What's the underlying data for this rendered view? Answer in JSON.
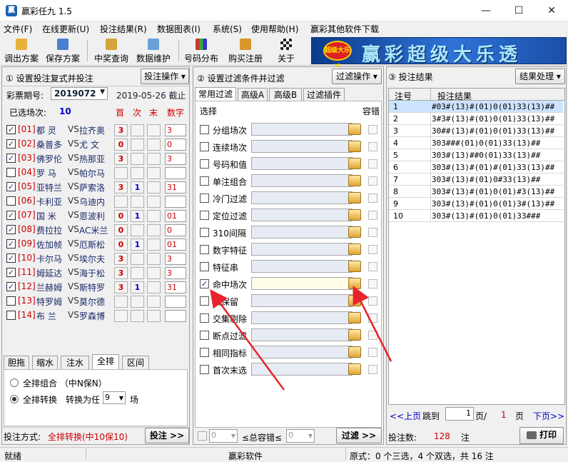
{
  "window": {
    "title": "赢彩任九 1.5",
    "min": "—",
    "max": "☐",
    "close": "✕",
    "icon": "app-icon"
  },
  "menu": [
    "文件(F)",
    "在线更新(U)",
    "投注结果(R)",
    "数据图表(I)",
    "系统(S)",
    "使用帮助(H)",
    "赢彩其他软件下载"
  ],
  "toolbar": [
    "调出方案",
    "保存方案",
    "中奖查询",
    "数据维护",
    "号码分布",
    "购买注册",
    "关于"
  ],
  "banner": {
    "logo": "超级大乐透",
    "text": "赢彩超级大乐透"
  },
  "left": {
    "title": "① 设置投注复式并投注",
    "action_button": "投注操作 ▾",
    "period_label": "彩票期号:",
    "period": "2019072",
    "date": "2019-05-26 截止",
    "selected_label": "已选场次:",
    "selected_count": "10",
    "col_headers": [
      "首",
      "次",
      "末",
      "数字"
    ],
    "matches": [
      {
        "checked": true,
        "no": "[01]",
        "home": "都 灵",
        "away": "拉齐奥",
        "c1": "3",
        "c2": "",
        "c3": "",
        "num": "3"
      },
      {
        "checked": true,
        "no": "[02]",
        "home": "桑普多",
        "away": "尤 文",
        "c1": "0",
        "c2": "",
        "c3": "",
        "num": "0"
      },
      {
        "checked": true,
        "no": "[03]",
        "home": "佛罗伦",
        "away": "热那亚",
        "c1": "3",
        "c2": "",
        "c3": "",
        "num": "3"
      },
      {
        "checked": false,
        "no": "[04]",
        "home": "罗 马",
        "away": "帕尔马",
        "c1": "",
        "c2": "",
        "c3": "",
        "num": ""
      },
      {
        "checked": true,
        "no": "[05]",
        "home": "亚特兰",
        "away": "萨索洛",
        "c1": "3",
        "c2": "1",
        "c3": "",
        "num": "31"
      },
      {
        "checked": false,
        "no": "[06]",
        "home": "卡利亚",
        "away": "乌迪内",
        "c1": "",
        "c2": "",
        "c3": "",
        "num": ""
      },
      {
        "checked": true,
        "no": "[07]",
        "home": "国 米",
        "away": "恩波利",
        "c1": "0",
        "c2": "1",
        "c3": "",
        "num": "01"
      },
      {
        "checked": true,
        "no": "[08]",
        "home": "费拉拉",
        "away": "AC米兰",
        "c1": "0",
        "c2": "",
        "c3": "",
        "num": "0"
      },
      {
        "checked": true,
        "no": "[09]",
        "home": "佐加帧",
        "away": "厄斯松",
        "c1": "0",
        "c2": "1",
        "c3": "",
        "num": "01"
      },
      {
        "checked": true,
        "no": "[10]",
        "home": "卡尔马",
        "away": "埃尔夫",
        "c1": "3",
        "c2": "",
        "c3": "",
        "num": "3"
      },
      {
        "checked": true,
        "no": "[11]",
        "home": "姆延达",
        "away": "海于松",
        "c1": "3",
        "c2": "",
        "c3": "",
        "num": "3"
      },
      {
        "checked": true,
        "no": "[12]",
        "home": "兰赫姆",
        "away": "斯特罗",
        "c1": "3",
        "c2": "1",
        "c3": "",
        "num": "31"
      },
      {
        "checked": false,
        "no": "[13]",
        "home": "特罗姆",
        "away": "莫尔德",
        "c1": "",
        "c2": "",
        "c3": "",
        "num": ""
      },
      {
        "checked": false,
        "no": "[14]",
        "home": "布 兰",
        "away": "罗森博",
        "c1": "",
        "c2": "",
        "c3": "",
        "num": ""
      }
    ],
    "vs": "VS",
    "tabs": [
      "胆拖",
      "缩水",
      "注水",
      "全排",
      "区间"
    ],
    "opt1": "全排组合 （中N保N）",
    "opt2": "全排转换",
    "convert_label": "转换为任",
    "convert_value": "9",
    "convert_unit": "场",
    "bet_method_label": "投注方式:",
    "bet_method": "全排转换(中10保10)",
    "bet_button": "投注 >>"
  },
  "mid": {
    "title": "② 设置过滤条件并过滤",
    "action_button": "过滤操作 ▾",
    "tabs": [
      "常用过滤",
      "高级A",
      "高级B",
      "过滤插件"
    ],
    "col_select": "选择",
    "col_tol": "容错",
    "filters": [
      {
        "label": "分组场次",
        "checked": false
      },
      {
        "label": "连续场次",
        "checked": false
      },
      {
        "label": "号码和值",
        "checked": false
      },
      {
        "label": "单注组合",
        "checked": false
      },
      {
        "label": "冷门过滤",
        "checked": false
      },
      {
        "label": "定位过滤",
        "checked": false
      },
      {
        "label": "310间隔",
        "checked": false
      },
      {
        "label": "数字特征",
        "checked": false
      },
      {
        "label": "特征串",
        "checked": false
      },
      {
        "label": "命中场次",
        "checked": true
      },
      {
        "label": "集保留",
        "checked": false
      },
      {
        "label": "交集剔除",
        "checked": false
      },
      {
        "label": "断点过滤",
        "checked": false
      },
      {
        "label": "相同指标",
        "checked": false
      },
      {
        "label": "首次末选",
        "checked": false
      }
    ],
    "tol_min": "0",
    "tol_label": "≤总容错≤",
    "tol_max": "0",
    "filter_button": "过滤 >>"
  },
  "right": {
    "title": "③ 投注结果",
    "action_button": "结果处理 ▾",
    "col_no": "注号",
    "col_result": "投注结果",
    "rows": [
      {
        "no": "1",
        "result": "#03#(13)#(01)0(01)33(13)##"
      },
      {
        "no": "2",
        "result": "3#3#(13)#(01)0(01)33(13)##"
      },
      {
        "no": "3",
        "result": "30##(13)#(01)0(01)33(13)##"
      },
      {
        "no": "4",
        "result": "303###(01)0(01)33(13)##"
      },
      {
        "no": "5",
        "result": "303#(13)##0(01)33(13)##"
      },
      {
        "no": "6",
        "result": "303#(13)#(01)#(01)33(13)##"
      },
      {
        "no": "7",
        "result": "303#(13)#(01)0#33(13)##"
      },
      {
        "no": "8",
        "result": "303#(13)#(01)0(01)#3(13)##"
      },
      {
        "no": "9",
        "result": "303#(13)#(01)0(01)3#(13)##"
      },
      {
        "no": "10",
        "result": "303#(13)#(01)0(01)33###"
      }
    ],
    "prev": "<<上页",
    "jump": "跳到",
    "page_input": "1",
    "page_sep": "页/",
    "total_pages": "1",
    "page_unit": "页",
    "next": "下页>>",
    "count_label": "投注数:",
    "count": "128",
    "count_unit": "注",
    "print_button": "打印"
  },
  "status": {
    "left": "就绪",
    "mid": "赢彩软件",
    "right": "原式：0 个三选，4 个双选，共 16 注"
  }
}
